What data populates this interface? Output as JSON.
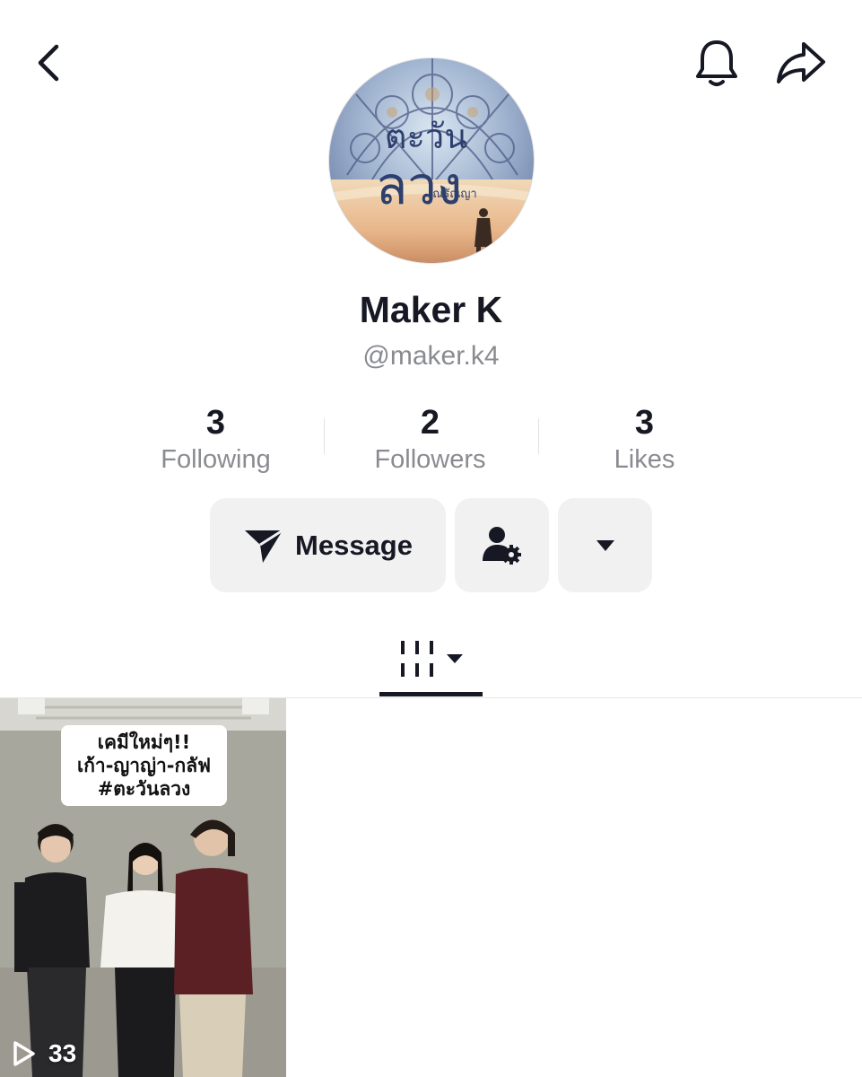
{
  "header": {
    "back_icon": "chevron-left-icon",
    "notification_icon": "bell-icon",
    "share_icon": "share-arrow-icon"
  },
  "profile": {
    "avatar_title_line1": "ตะวัน",
    "avatar_title_line2": "ลวง",
    "avatar_author": "ณรัณญา",
    "name": "Maker K",
    "handle": "@maker.k4"
  },
  "stats": [
    {
      "value": "3",
      "label": "Following"
    },
    {
      "value": "2",
      "label": "Followers"
    },
    {
      "value": "3",
      "label": "Likes"
    }
  ],
  "actions": {
    "message_label": "Message",
    "message_icon": "send-icon",
    "add_friend_icon": "user-settings-icon",
    "more_icon": "caret-down-icon"
  },
  "tabs": {
    "videos_icon": "video-grid-icon",
    "dropdown_icon": "caret-down-icon"
  },
  "videos": [
    {
      "caption_lines": [
        "เคมีใหม่ๆ!!",
        "เก้า-ญาญ่า-กลัฟ",
        "#ตะวันลวง"
      ],
      "play_count": "33"
    }
  ]
}
